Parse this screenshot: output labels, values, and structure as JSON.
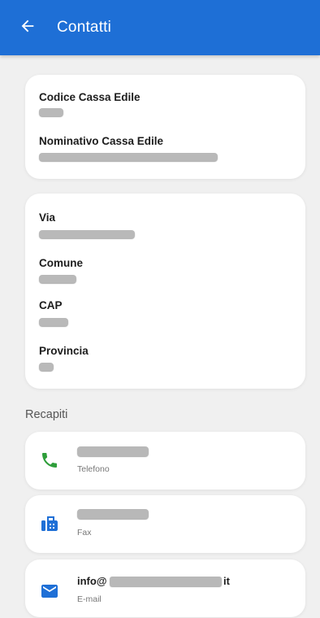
{
  "appbar": {
    "title": "Contatti",
    "back_icon": "arrow-left-icon",
    "color": "#1e6fd6"
  },
  "cassa_card": {
    "codice_label": "Codice Cassa Edile",
    "codice_value": "",
    "nominativo_label": "Nominativo Cassa Edile",
    "nominativo_value": ""
  },
  "address_card": {
    "via_label": "Via",
    "via_value": "",
    "comune_label": "Comune",
    "comune_value": "",
    "cap_label": "CAP",
    "cap_value": "",
    "provincia_label": "Provincia",
    "provincia_value": ""
  },
  "recapiti": {
    "title": "Recapiti",
    "telefono": {
      "caption": "Telefono",
      "icon": "phone-icon",
      "icon_color": "#2e9e3a"
    },
    "fax": {
      "caption": "Fax",
      "icon": "fax-icon",
      "icon_color": "#1e6fd6"
    },
    "email": {
      "caption": "E-mail",
      "prefix": "info@",
      "suffix": "it",
      "icon": "mail-icon",
      "icon_color": "#1e6fd6"
    }
  }
}
